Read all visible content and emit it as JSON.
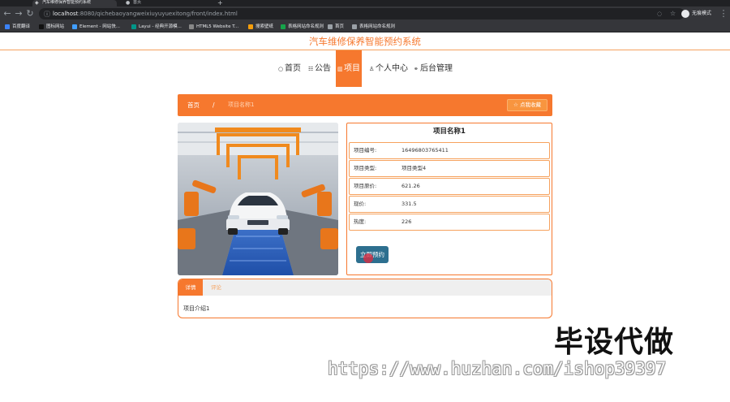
{
  "browser": {
    "tabs": [
      {
        "title": "汽车维修保养智能预约系统",
        "active": true
      },
      {
        "title": "首页",
        "active": false
      }
    ],
    "new_tab_glyph": "+",
    "url_host": "localhost",
    "url_rest": ":8080/qichebaoyangweixiuyuyuexitong/front/index.html",
    "profile_label": "无痕模式",
    "bookmarks": [
      {
        "label": "百度翻译",
        "color": "#3b82f6"
      },
      {
        "label": "图标网站",
        "color": "#111111"
      },
      {
        "label": "Element - 网站快...",
        "color": "#409eff"
      },
      {
        "label": "Layui - 经典开源模...",
        "color": "#009688"
      },
      {
        "label": "HTML5 Website T...",
        "color": "#888888"
      },
      {
        "label": "搜索壁纸",
        "color": "#f59e0b"
      },
      {
        "label": "表格网站命名规则",
        "color": "#16a34a"
      },
      {
        "label": "首页",
        "color": "#9aa0a6"
      },
      {
        "label": "表格网站命名规则",
        "color": "#9aa0a6"
      }
    ]
  },
  "site": {
    "title": "汽车维修保养智能预约系统",
    "accent": "#f6782e",
    "nav": [
      {
        "icon": "○",
        "icon_name": "home-icon",
        "label": "首页",
        "active": false
      },
      {
        "icon": "☷",
        "icon_name": "notice-icon",
        "label": "公告",
        "active": false
      },
      {
        "icon": "▥",
        "icon_name": "project-icon",
        "label": "项目",
        "active": true
      },
      {
        "icon": "♙",
        "icon_name": "user-icon",
        "label": "个人中心",
        "active": false
      },
      {
        "icon": "⚭",
        "icon_name": "link-icon",
        "label": "后台管理",
        "active": false
      }
    ]
  },
  "breadcrumb": {
    "home": "首页",
    "separator": "/",
    "current": "项目名称1",
    "favorite_label": "☆ 点我收藏"
  },
  "detail": {
    "title": "项目名称1",
    "fields": [
      {
        "label": "项目编号:",
        "value": "16496803765411"
      },
      {
        "label": "项目类型:",
        "value": "项目类型4"
      },
      {
        "label": "项目原价:",
        "value": "621.26"
      },
      {
        "label": "现价:",
        "value": "331.5"
      },
      {
        "label": "热度:",
        "value": "226"
      }
    ],
    "book_button": "立即预约"
  },
  "tabs": {
    "items": [
      "详情",
      "评论"
    ],
    "active": "详情",
    "content": "项目介绍1"
  },
  "watermark": {
    "cn": "毕设代做",
    "url": "https://www.huzhan.com/ishop39397"
  }
}
